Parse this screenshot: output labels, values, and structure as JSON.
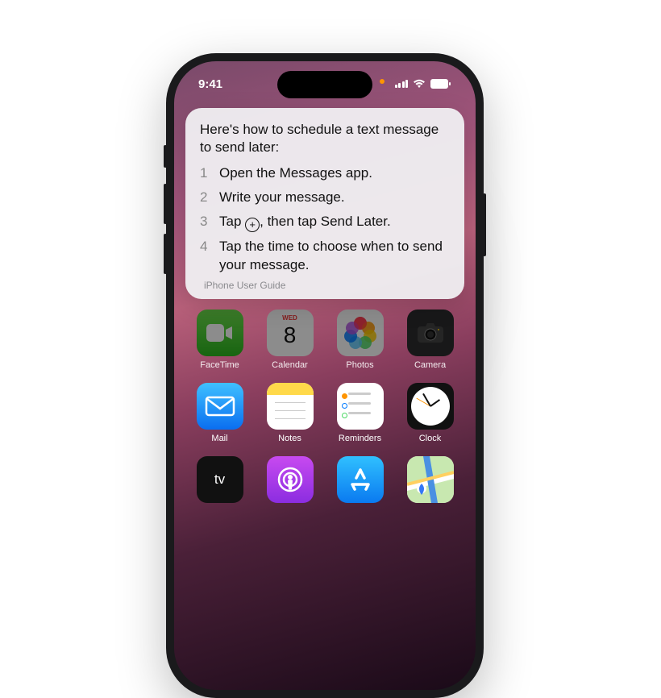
{
  "status": {
    "time": "9:41"
  },
  "card": {
    "title": "Here's how to schedule a text message to send later:",
    "steps": [
      "Open the Messages app.",
      "Write your message.",
      "Tap {plus}, then tap Send Later.",
      "Tap the time to choose when to send your message."
    ],
    "source": "iPhone User Guide"
  },
  "apps": {
    "row1": [
      "FaceTime",
      "Calendar",
      "Photos",
      "Camera"
    ],
    "row2": [
      "Mail",
      "Notes",
      "Reminders",
      "Clock"
    ]
  }
}
